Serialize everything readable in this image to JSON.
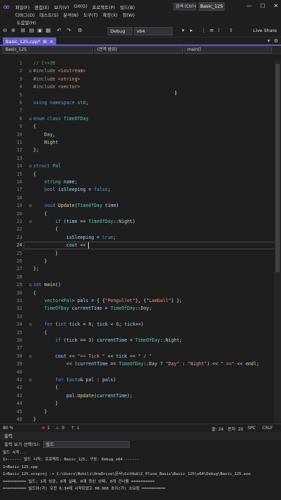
{
  "titlebar": {
    "menu_row1": [
      "파일(F)",
      "편집(E)",
      "보기(V)",
      "Git(G)",
      "프로젝트(P)",
      "빌드(B)"
    ],
    "menu_row2": [
      "디버그(D)",
      "테스트(S)",
      "분석(N)",
      "도구(T)",
      "확장(X)",
      "창(W)"
    ],
    "menu_row3": [
      "도움말(H)"
    ],
    "search": "검색 (Ctrl+Q)",
    "project_name": "Basic_125"
  },
  "toolbar": {
    "config": "Debug",
    "platform": "x64",
    "live_share": "Live Share"
  },
  "tab": {
    "label": "Basic_125.cpp*",
    "pin": "⊞",
    "close": "✕"
  },
  "navbar": {
    "project": "Basic_125",
    "scope": "(전역 범위)",
    "member": "main()"
  },
  "code": {
    "lines": [
      {
        "n": "1",
        "fold": "",
        "html": "<span class='cm'>// C++20</span>"
      },
      {
        "n": "2",
        "fold": "⊟",
        "html": "<span class='pp'>#include</span> <span class='st'>&lt;iostream&gt;</span>"
      },
      {
        "n": "3",
        "fold": "",
        "html": "<span class='pp'>#include</span> <span class='st'>&lt;string&gt;</span>"
      },
      {
        "n": "4",
        "fold": "",
        "html": "<span class='pp'>#include</span> <span class='st'>&lt;vector&gt;</span>"
      },
      {
        "n": "5",
        "fold": "",
        "html": ""
      },
      {
        "n": "6",
        "fold": "",
        "html": "<span class='kw'>using</span> <span class='kw'>namespace</span> <span class='ty'>std</span>;"
      },
      {
        "n": "7",
        "fold": "",
        "html": ""
      },
      {
        "n": "8",
        "fold": "⊟",
        "html": "<span class='kw'>enum</span> <span class='kw'>class</span> <span class='ty'>TimeOfDay</span>"
      },
      {
        "n": "9",
        "fold": "",
        "html": "{"
      },
      {
        "n": "10",
        "fold": "",
        "html": "    <span class='en'>Day</span>,"
      },
      {
        "n": "11",
        "fold": "",
        "html": "    <span class='en'>Night</span>"
      },
      {
        "n": "12",
        "fold": "",
        "html": "};"
      },
      {
        "n": "13",
        "fold": "",
        "html": ""
      },
      {
        "n": "14",
        "fold": "⊟",
        "html": "<span class='kw'>struct</span> <span class='ty'>Pal</span>"
      },
      {
        "n": "15",
        "fold": "",
        "html": "{"
      },
      {
        "n": "16",
        "fold": "",
        "html": "    <span class='ty'>string</span> <span class='va'>name</span>;"
      },
      {
        "n": "17",
        "fold": "",
        "html": "    <span class='kw'>bool</span> <span class='va'>isSleeping</span> = <span class='kw'>false</span>;"
      },
      {
        "n": "18",
        "fold": "",
        "html": ""
      },
      {
        "n": "19",
        "fold": "⊟",
        "html": "    <span class='kw'>void</span> <span class='fn'>Update</span>(<span class='ty'>TimeOfDay</span> <span class='va'>time</span>)"
      },
      {
        "n": "20",
        "fold": "",
        "html": "    {"
      },
      {
        "n": "21",
        "fold": "⊟",
        "html": "        <span class='kw'>if</span> (<span class='va'>time</span> == <span class='ty'>TimeOfDay</span>::<span class='en'>Night</span>)"
      },
      {
        "n": "22",
        "fold": "",
        "html": "        {"
      },
      {
        "n": "23",
        "fold": "",
        "html": "            <span class='va'>isSleeping</span> = <span class='kw'>true</span>;"
      },
      {
        "n": "24",
        "fold": "",
        "html": "            <span class='va'>cout</span> &lt;&lt;"
      },
      {
        "n": "25",
        "fold": "",
        "html": "        }"
      },
      {
        "n": "26",
        "fold": "",
        "html": "    }"
      },
      {
        "n": "27",
        "fold": "",
        "html": "};"
      },
      {
        "n": "28",
        "fold": "",
        "html": ""
      },
      {
        "n": "29",
        "fold": "⊟",
        "html": "<span class='kw'>int</span> <span class='fn'>main</span>()"
      },
      {
        "n": "30",
        "fold": "",
        "html": "{"
      },
      {
        "n": "31",
        "fold": "",
        "html": "    <span class='ty'>vector</span>&lt;<span class='ty'>Pal</span>&gt; <span class='va'>pals</span> = { {<span class='st'>\"Pengullet\"</span>}, {<span class='st'>\"Lamball\"</span>} };"
      },
      {
        "n": "32",
        "fold": "",
        "html": "    <span class='ty'>TimeOfDay</span> <span class='va'>currentTime</span> = <span class='ty'>TimeOfDay</span>::<span class='en'>Day</span>;"
      },
      {
        "n": "33",
        "fold": "",
        "html": ""
      },
      {
        "n": "34",
        "fold": "⊟",
        "html": "    <span class='kw'>for</span> (<span class='kw'>int</span> <span class='va'>tick</span> = <span class='nm'>0</span>; <span class='va'>tick</span> &lt; <span class='nm'>6</span>; <span class='va'>tick</span>++)"
      },
      {
        "n": "35",
        "fold": "",
        "html": "    {"
      },
      {
        "n": "36",
        "fold": "",
        "html": "        <span class='kw'>if</span> (<span class='va'>tick</span> == <span class='nm'>3</span>) <span class='va'>currentTime</span> = <span class='ty'>TimeOfDay</span>::<span class='en'>Night</span>;"
      },
      {
        "n": "37",
        "fold": "",
        "html": ""
      },
      {
        "n": "38",
        "fold": "⊟",
        "html": "        <span class='va'>cout</span> &lt;&lt; <span class='st'>\"== Tick \"</span> &lt;&lt; <span class='va'>tick</span> &lt;&lt; <span class='st'>\" / \"</span>"
      },
      {
        "n": "39",
        "fold": "",
        "html": "            &lt;&lt; (<span class='va'>currentTime</span> == <span class='ty'>TimeOfDay</span>::<span class='en'>Day</span> ? <span class='st'>\"Day\"</span> : <span class='st'>\"Night\"</span>) &lt;&lt; <span class='st'>\" ==\"</span> &lt;&lt; <span class='fn'>endl</span>;"
      },
      {
        "n": "40",
        "fold": "",
        "html": ""
      },
      {
        "n": "41",
        "fold": "⊟",
        "html": "        <span class='kw'>for</span> (<span class='kw'>auto</span>&amp; <span class='va'>pal</span> : <span class='va'>pals</span>)"
      },
      {
        "n": "42",
        "fold": "",
        "html": "        {"
      },
      {
        "n": "43",
        "fold": "",
        "html": "            <span class='va'>pal</span>.<span class='fn'>Update</span>(<span class='va'>currentTime</span>);"
      },
      {
        "n": "44",
        "fold": "",
        "html": "        }"
      },
      {
        "n": "45",
        "fold": "",
        "html": "    }"
      },
      {
        "n": "46",
        "fold": "",
        "html": "}"
      },
      {
        "n": "47",
        "fold": "",
        "html": ""
      }
    ]
  },
  "statusbar": {
    "zoom": "80 %",
    "errors": "1",
    "warnings": "0",
    "line": "줄: 24",
    "col": "문자: 20",
    "spc": "SPC",
    "eol": "CRLF"
  },
  "output": {
    "title": "출력",
    "source_label": "출력 보기 선택(S):",
    "source_value": "빌드",
    "lines": [
      "빌드 시작...",
      "1>------ 빌드 시작: 프로젝트: Basic_125, 구성: Debug x64 ------",
      "1>Basic_125.cpp",
      "1>Basic_125.vcxproj -> C:\\Users\\Mobili\\OneDrive\\문서\\GitHub\\C_Pluse_Basic\\Basic_125\\x64\\Debug\\Basic_125.exe",
      "========== 빌드: 1개 성공, 0개 실패, 0개 최신 상태, 0개 건너뜀 ==========",
      "========== 빌드이(가) 오전 6:34에 시작되었고 00.966 초이(가) 소요됨 =========="
    ]
  }
}
